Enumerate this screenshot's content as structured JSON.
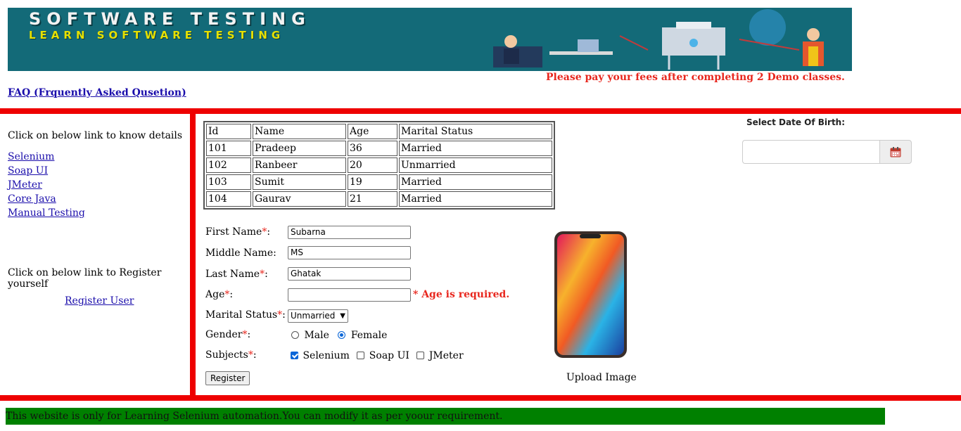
{
  "banner": {
    "title": "SOFTWARE TESTING",
    "subtitle": "LEARN SOFTWARE TESTING"
  },
  "notice": "Please pay your fees after completing 2 Demo classes.",
  "faq_link": "FAQ (Frquently Asked Qusetion)",
  "left": {
    "intro": "Click on below link to know details",
    "links": [
      "Selenium",
      "Soap UI",
      "JMeter",
      "Core Java",
      "Manual Testing"
    ],
    "register_intro": "Click on below link to Register yourself",
    "register_link": "Register User"
  },
  "table": {
    "headers": [
      "Id",
      "Name",
      "Age",
      "Marital Status"
    ],
    "rows": [
      [
        "101",
        "Pradeep",
        "36",
        "Married"
      ],
      [
        "102",
        "Ranbeer",
        "20",
        "Unmarried"
      ],
      [
        "103",
        "Sumit",
        "19",
        "Married"
      ],
      [
        "104",
        "Gaurav",
        "21",
        "Married"
      ]
    ]
  },
  "form": {
    "first_name_label": "First Name",
    "middle_name_label": "Middle Name:",
    "last_name_label": "Last Name",
    "age_label": "Age",
    "marital_label": "Marital Status",
    "gender_label": "Gender",
    "subjects_label": "Subjects",
    "required_mark": "*",
    "colon": ":",
    "first_name_value": "Subarna",
    "middle_name_value": "MS",
    "last_name_value": "Ghatak",
    "age_value": "",
    "age_error": "* Age is required.",
    "marital_selected": "Unmarried",
    "gender_male": "Male",
    "gender_female": "Female",
    "subject_selenium": "Selenium",
    "subject_soapui": "Soap UI",
    "subject_jmeter": "JMeter",
    "register_button": "Register"
  },
  "upload_label": "Upload Image",
  "dob": {
    "label": "Select Date Of Birth:",
    "value": ""
  },
  "footer": "This website is only for Learning Selenium automation.You can modify it as per yoour requirement.",
  "colors": {
    "banner_bg": "#136a78",
    "red_bar": "#ee0000",
    "footer_bg": "#008000",
    "link": "#1a0dab",
    "error": "#e8271e"
  },
  "icons": [
    "calendar-icon",
    "phone-image"
  ]
}
